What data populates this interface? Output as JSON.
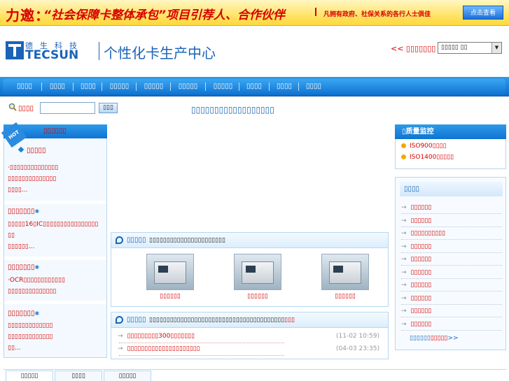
{
  "banner": {
    "prefix": "力邀：",
    "headline": "“社会保障卡整体承包”项目引荐人、合作伙伴",
    "note": "凡拥有政府、社保关系的各行人士俱佳",
    "cta_label": "点击查看"
  },
  "header": {
    "logo_cn": "德生科技",
    "logo_en": "TECSUN",
    "site_title": "个性化卡生产中心",
    "links_label": "<< ▯▯▯▯▯▯▯",
    "links_select_value": "▯▯▯▯▯ ▯▯"
  },
  "nav": {
    "items": [
      "▯▯▯▯",
      "▯▯▯▯",
      "▯▯▯▯",
      "▯▯▯▯▯",
      "▯▯▯▯▯",
      "▯▯▯▯▯",
      "▯▯▯▯▯",
      "▯▯▯▯",
      "▯▯▯▯",
      "▯▯▯▯"
    ]
  },
  "search": {
    "label": "▯▯▯▯",
    "button_label": "▯▯▯",
    "marquee": "▯▯▯▯▯▯▯▯▯▯▯▯▯▯▯▯▯▯"
  },
  "hot": {
    "ribbon": "HOT",
    "title": "▯▯▯▯▯▯",
    "subtitle": "▯▯▯▯▯",
    "block1": [
      "·▯▯▯▯▯▯▯▯▯▯▯▯▯▯",
      "▯▯▯▯▯▯▯▯▯▯▯▯▯▯",
      "▯▯▯▯..."
    ],
    "block2_title": "▯▯▯▯▯▯▯",
    "block2": [
      "▯▯▯▯▯16▯IC▯▯▯▯▯▯▯▯▯▯▯▯▯▯▯▯",
      "▯▯",
      "▯▯▯▯▯▯..."
    ],
    "block3_title": "▯▯▯▯▯▯▯",
    "block3": [
      "·OCR▯▯▯▯▯▯▯▯▯▯▯▯",
      "▯▯▯▯▯▯▯▯▯▯▯▯▯▯"
    ],
    "block4_title": "▯▯▯▯▯▯▯",
    "block4": [
      "▯▯▯▯▯▯▯▯▯▯▯▯▯",
      "▯▯▯▯▯▯▯▯▯▯▯▯▯",
      "▯▯..."
    ]
  },
  "products": {
    "title": "▯▯▯▯▯",
    "subtitle": "▯▯▯▯▯▯▯▯▯▯▯▯▯▯▯▯▯▯▯▯▯▯",
    "items": [
      {
        "name": "▯▯▯▯▯▯"
      },
      {
        "name": "▯▯▯▯▯▯"
      },
      {
        "name": "▯▯▯▯▯▯"
      }
    ]
  },
  "news": {
    "title": "▯▯▯▯▯",
    "subtitle": "▯▯▯▯▯▯▯▯▯▯▯▯▯▯▯▯▯▯▯▯▯▯▯▯▯▯▯▯▯▯▯▯▯▯▯▯▯▯▯",
    "subtitle_new": "▯▯▯",
    "rows": [
      {
        "text": "▯▯▯▯▯▯▯▯▯300▯▯▯▯▯▯▯",
        "date": "(11-02 10:59)"
      },
      {
        "text": "▯▯▯▯▯▯▯▯▯▯▯▯▯▯▯▯▯▯▯▯▯",
        "date": "(04-03 23:35)"
      }
    ]
  },
  "quality": {
    "title": "▯质量监控",
    "items": [
      "ISO900▯▯▯▯",
      "ISO1400▯▯▯▯▯"
    ]
  },
  "right_news": {
    "title": "▯▯▯▯",
    "items": [
      "▯▯▯▯▯▯",
      "▯▯▯▯▯▯",
      "▯▯▯▯▯▯▯▯▯▯",
      "▯▯▯▯▯▯",
      "▯▯▯▯▯▯",
      "▯▯▯▯▯▯",
      "▯▯▯▯▯▯",
      "▯▯▯▯▯▯",
      "▯▯▯▯▯▯",
      "▯▯▯▯▯▯"
    ],
    "more_prefix": "▯▯▯▯▯▯",
    "more_red": "▯▯▯▯▯",
    "more_suffix": ">>"
  },
  "bottom_tabs": [
    "▯▯▯▯▯",
    "▯▯▯▯",
    "▯▯▯▯▯"
  ]
}
